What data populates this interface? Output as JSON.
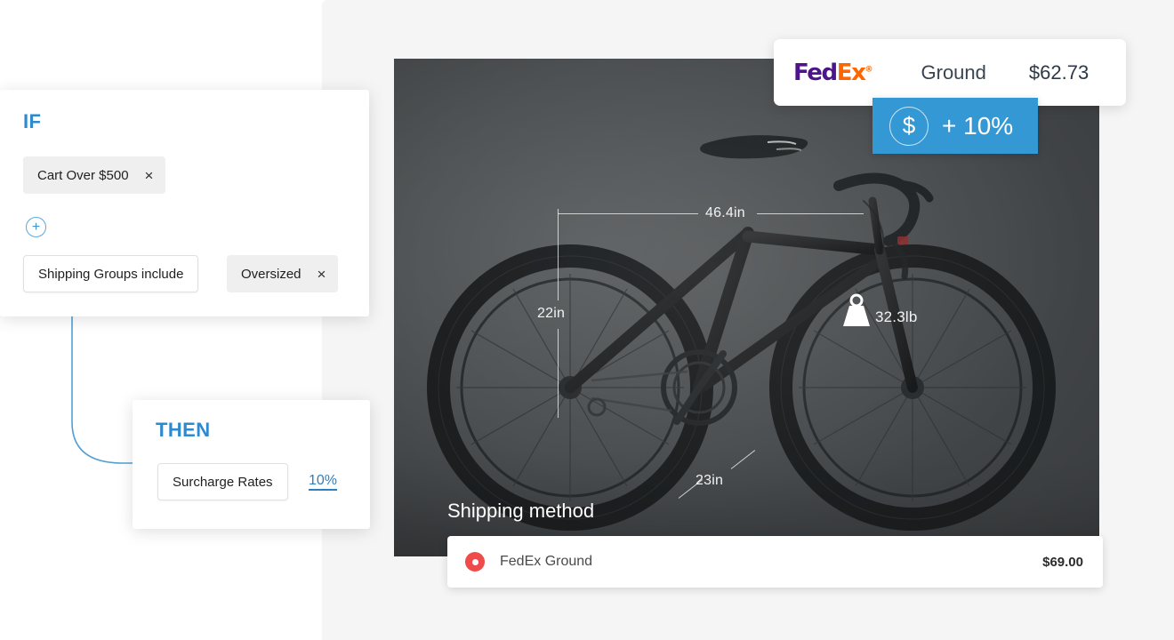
{
  "rule_builder": {
    "if_card": {
      "heading": "IF",
      "conditions": [
        {
          "label": "Cart Over $500",
          "remove_icon": "×"
        }
      ],
      "add_button_icon": "+",
      "group_rule": {
        "operator_label": "Shipping Groups include",
        "value_label": "Oversized",
        "remove_icon": "×"
      }
    },
    "then_card": {
      "heading": "THEN",
      "action_label": "Surcharge Rates",
      "action_value": "10%"
    },
    "accent_color": "#2e8ace"
  },
  "product_preview": {
    "dimensions": {
      "width": "46.4in",
      "height": "22in",
      "depth": "23in",
      "weight": "32.3lb"
    },
    "weight_icon": "weight-icon",
    "shipping_method": {
      "title": "Shipping method",
      "options": [
        {
          "label": "FedEx Ground",
          "price": "$69.00",
          "selected": true,
          "radio_icon": "radio-selected-icon"
        }
      ]
    }
  },
  "rate_callout": {
    "carrier_logo": {
      "part_one": "Fed",
      "part_two": "Ex",
      "registered_mark": "®",
      "color_one": "#4d148c",
      "color_two": "#ff6600"
    },
    "service": "Ground",
    "price": "$62.73",
    "surcharge": {
      "currency_icon": "$",
      "text": "+ 10%",
      "background_color": "#3498d4"
    }
  }
}
